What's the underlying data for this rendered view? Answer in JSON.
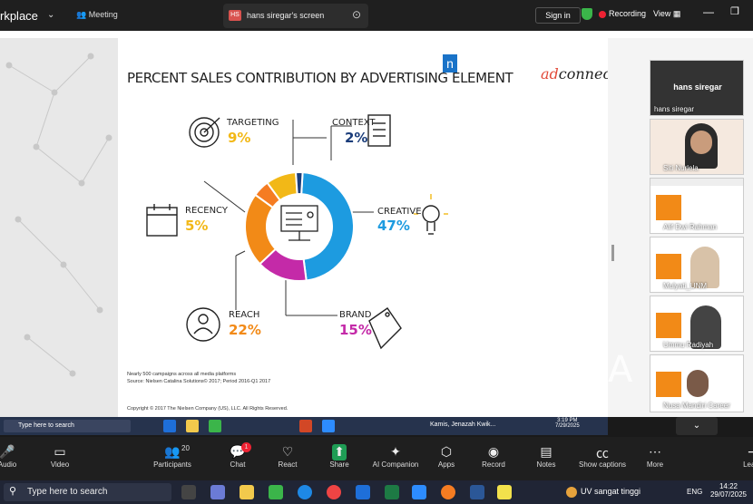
{
  "topbar": {
    "workspace": "rkplace",
    "meeting": "Meeting",
    "tab_title": "hans siregar's screen",
    "tab_badge": "HS",
    "signin": "Sign in",
    "recording": "Recording",
    "view": "View"
  },
  "slide": {
    "title": "PERCENT SALES CONTRIBUTION BY ADVERTISING ELEMENT",
    "nielsen": "n",
    "brand": "ad",
    "brand2": "connect",
    "elements": [
      {
        "label": "TARGETING",
        "pct": "9%",
        "color": "#f2b817"
      },
      {
        "label": "CONTEXT",
        "pct": "2%",
        "color": "#1b3d7a"
      },
      {
        "label": "CREATIVE",
        "pct": "47%",
        "color": "#1d9be0"
      },
      {
        "label": "RECENCY",
        "pct": "5%",
        "color": "#f2b817"
      },
      {
        "label": "BRAND",
        "pct": "15%",
        "color": "#c42aa8"
      },
      {
        "label": "REACH",
        "pct": "22%",
        "color": "#f28a17"
      }
    ],
    "foot1": "Nearly 500 campaigns across all media platforms",
    "foot2": "Source: Nielsen Catalina Solutions© 2017; Period 2016-Q1 2017",
    "copyright": "Copyright © 2017 The Nielsen Company (US), LLC. All Rights Reserved."
  },
  "chart_data": {
    "type": "pie",
    "title": "PERCENT SALES CONTRIBUTION BY ADVERTISING ELEMENT",
    "categories": [
      "CREATIVE",
      "BRAND",
      "REACH",
      "RECENCY",
      "TARGETING",
      "CONTEXT"
    ],
    "values": [
      47,
      15,
      22,
      5,
      9,
      2
    ],
    "colors": [
      "#1d9be0",
      "#c42aa8",
      "#f28a17",
      "#f57c22",
      "#f2b817",
      "#1b3d7a"
    ]
  },
  "participants": {
    "host": "hans siregar",
    "host_sub": "hans siregar",
    "list": [
      "Siti Nurlela",
      "Alif Dwi Rahman",
      "Mulyati_UNM",
      "Ummu Radiyah",
      "Nusa Mandiri Career"
    ]
  },
  "inner_taskbar": {
    "search": "Type here to search",
    "news": "Kamis, Jenazah Kwik...",
    "time": "3:19 PM",
    "date": "7/29/2025"
  },
  "controls": [
    {
      "label": "Audio",
      "icon": "mic-icon"
    },
    {
      "label": "Video",
      "icon": "video-icon"
    },
    {
      "label": "Participants",
      "icon": "people-icon",
      "count": "20"
    },
    {
      "label": "Chat",
      "icon": "chat-icon",
      "badge": "1"
    },
    {
      "label": "React",
      "icon": "heart-icon"
    },
    {
      "label": "Share",
      "icon": "share-icon"
    },
    {
      "label": "AI Companion",
      "icon": "sparkle-icon"
    },
    {
      "label": "Apps",
      "icon": "apps-icon"
    },
    {
      "label": "Record",
      "icon": "record-icon"
    },
    {
      "label": "Notes",
      "icon": "notes-icon"
    },
    {
      "label": "Show captions",
      "icon": "cc-icon"
    },
    {
      "label": "More",
      "icon": "more-icon"
    },
    {
      "label": "Leave",
      "icon": "leave-icon"
    }
  ],
  "wintb": {
    "search": "Type here to search",
    "weather": "UV sangat tinggi",
    "lang": "ENG",
    "time": "14:22",
    "date": "29/07/2025"
  },
  "overlay_letter": "A"
}
